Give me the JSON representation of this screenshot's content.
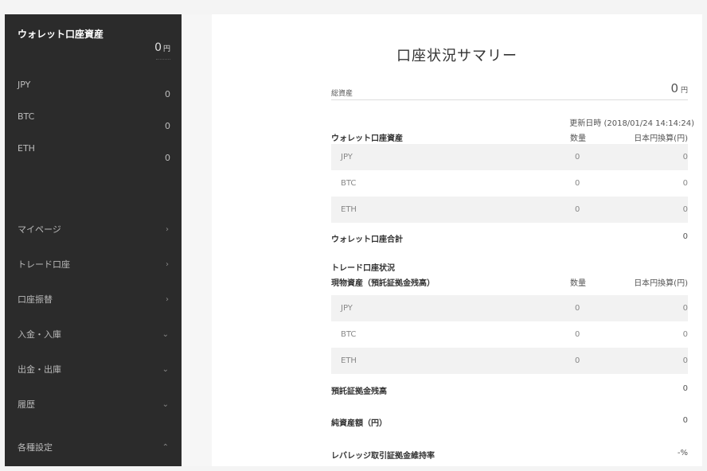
{
  "sidebar": {
    "wallet_title": "ウォレット口座資産",
    "wallet_total": "0",
    "wallet_total_unit": "円",
    "balances": [
      {
        "currency": "JPY",
        "amount": "0"
      },
      {
        "currency": "BTC",
        "amount": "0"
      },
      {
        "currency": "ETH",
        "amount": "0"
      }
    ],
    "nav": [
      {
        "label": "マイページ",
        "chevron": "›"
      },
      {
        "label": "トレード口座",
        "chevron": "›"
      },
      {
        "label": "口座振替",
        "chevron": "›"
      },
      {
        "label": "入金・入庫",
        "chevron": "⌄"
      },
      {
        "label": "出金・出庫",
        "chevron": "⌄"
      },
      {
        "label": "履歴",
        "chevron": "⌄"
      },
      {
        "label": "各種設定",
        "chevron": "⌃"
      }
    ]
  },
  "summary": {
    "title": "口座状況サマリー",
    "total_label": "総資産",
    "total_value": "0",
    "total_unit": "円",
    "updated": "更新日時 (2018/01/24 14:14:24)",
    "wallet": {
      "heading": "ウォレット口座資産",
      "col_qty": "数量",
      "col_jpy": "日本円換算(円)",
      "rows": [
        {
          "currency": "JPY",
          "qty": "0",
          "jpy": "0"
        },
        {
          "currency": "BTC",
          "qty": "0",
          "jpy": "0"
        },
        {
          "currency": "ETH",
          "qty": "0",
          "jpy": "0"
        }
      ],
      "total_label": "ウォレット口座合計",
      "total_value": "0"
    },
    "trade": {
      "heading": "トレード口座状況",
      "subheading": "現物資産（預託証拠金残高）",
      "col_qty": "数量",
      "col_jpy": "日本円換算(円)",
      "rows": [
        {
          "currency": "JPY",
          "qty": "0",
          "jpy": "0"
        },
        {
          "currency": "BTC",
          "qty": "0",
          "jpy": "0"
        },
        {
          "currency": "ETH",
          "qty": "0",
          "jpy": "0"
        }
      ]
    },
    "deposit_margin_label": "預託証拠金残高",
    "deposit_margin_value": "0",
    "net_asset_label": "純資産額（円）",
    "net_asset_value": "0",
    "leverage_label": "レバレッジ取引証拠金維持率",
    "leverage_value": "-%"
  }
}
